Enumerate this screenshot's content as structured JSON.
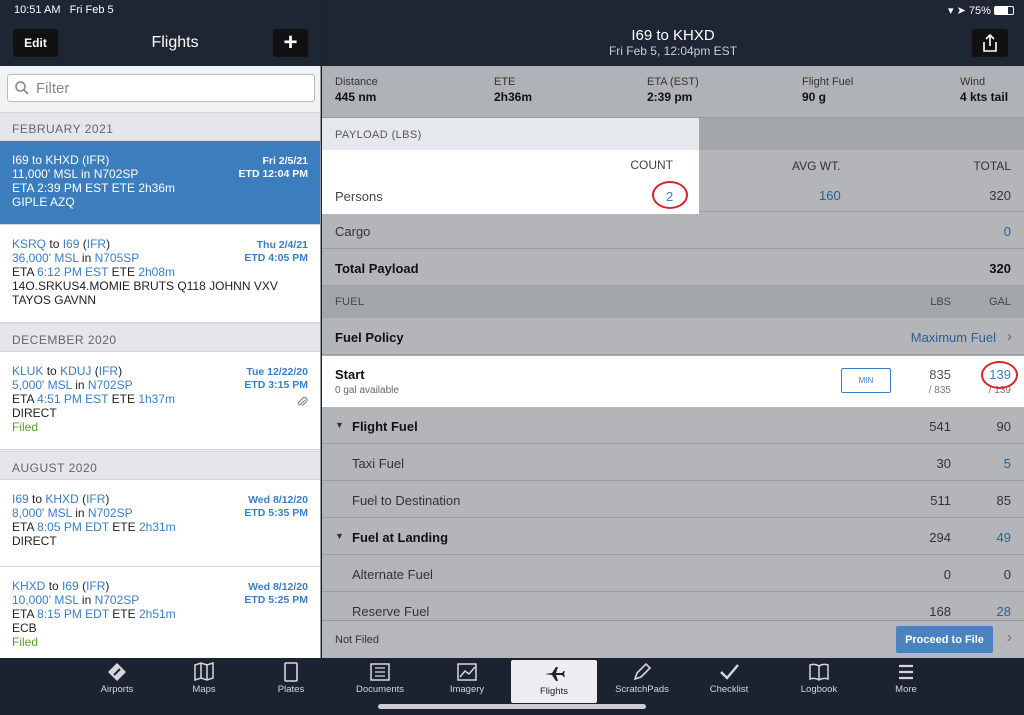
{
  "status": {
    "time": "10:51 AM",
    "date": "Fri Feb 5",
    "battery": "75%"
  },
  "left_header": {
    "edit_label": "Edit",
    "title": "Flights",
    "add_label": "+"
  },
  "filter": {
    "placeholder": "Filter"
  },
  "sections": [
    "FEBRUARY 2021",
    "DECEMBER 2020",
    "AUGUST 2020"
  ],
  "flights": [
    {
      "from": "I69",
      "to": "KHXD",
      "rules": "IFR",
      "date": "Fri 2/5/21",
      "etd": "ETD 12:04 PM",
      "alt": "11,000' MSL",
      "aircraft": "N702SP",
      "eta": "2:39 PM EST",
      "ete": "2h36m",
      "route": "GIPLE AZQ",
      "status": ""
    },
    {
      "from": "KSRQ",
      "to": "I69",
      "rules": "IFR",
      "date": "Thu 2/4/21",
      "etd": "ETD 4:05 PM",
      "alt": "36,000' MSL",
      "aircraft": "N705SP",
      "eta": "6:12 PM EST",
      "ete": "2h08m",
      "route": "14O.SRKUS4.MOMIE BRUTS Q118 JOHNN VXV TAYOS GAVNN",
      "status": ""
    },
    {
      "from": "KLUK",
      "to": "KDUJ",
      "rules": "IFR",
      "date": "Tue 12/22/20",
      "etd": "ETD 3:15 PM",
      "alt": "5,000' MSL",
      "aircraft": "N702SP",
      "eta": "4:51 PM EST",
      "ete": "1h37m",
      "route": "DIRECT",
      "status": "Filed"
    },
    {
      "from": "I69",
      "to": "KHXD",
      "rules": "IFR",
      "date": "Wed 8/12/20",
      "etd": "ETD 5:35 PM",
      "alt": "8,000' MSL",
      "aircraft": "N702SP",
      "eta": "8:05 PM EDT",
      "ete": "2h31m",
      "route": "DIRECT",
      "status": ""
    },
    {
      "from": "KHXD",
      "to": "I69",
      "rules": "IFR",
      "date": "Wed 8/12/20",
      "etd": "ETD 5:25 PM",
      "alt": "10,000' MSL",
      "aircraft": "N702SP",
      "eta": "8:15 PM EDT",
      "ete": "2h51m",
      "route": "ECB",
      "status": "Filed"
    }
  ],
  "words": {
    "to": "to",
    "in": "in",
    "eta": "ETA",
    "ete": "ETE"
  },
  "right_header": {
    "title": "I69 to KHXD",
    "subtitle": "Fri Feb 5, 12:04pm EST"
  },
  "summary": [
    {
      "label": "Distance",
      "value": "445 nm"
    },
    {
      "label": "ETE",
      "value": "2h36m"
    },
    {
      "label": "ETA (EST)",
      "value": "2:39 pm"
    },
    {
      "label": "Flight Fuel",
      "value": "90 g"
    },
    {
      "label": "Wind",
      "value": "4 kts tail"
    }
  ],
  "payload": {
    "header": "PAYLOAD (LBS)",
    "col_count": "COUNT",
    "col_avg": "AVG WT.",
    "col_total": "TOTAL",
    "persons_label": "Persons",
    "persons_count": "2",
    "persons_avg": "160",
    "persons_total": "320",
    "cargo_label": "Cargo",
    "cargo_total": "0",
    "total_label": "Total Payload",
    "total_value": "320"
  },
  "fuel": {
    "header": "FUEL",
    "col_lbs": "LBS",
    "col_gal": "GAL",
    "policy_label": "Fuel Policy",
    "policy_value": "Maximum Fuel",
    "start_label": "Start",
    "start_sub": "0 gal available",
    "min_label": "MIN",
    "start_lbs": "835",
    "start_lbs_max": "/ 835",
    "start_gal": "139",
    "start_gal_max": "/ 139",
    "rows": [
      {
        "label": "Flight Fuel",
        "lbs": "541",
        "gal": "90"
      },
      {
        "label": "Taxi Fuel",
        "lbs": "30",
        "gal": "5"
      },
      {
        "label": "Fuel to Destination",
        "lbs": "511",
        "gal": "85"
      },
      {
        "label": "Fuel at Landing",
        "lbs": "294",
        "gal": "49"
      },
      {
        "label": "Alternate Fuel",
        "lbs": "0",
        "gal": "0"
      },
      {
        "label": "Reserve Fuel",
        "lbs": "168",
        "gal": "28"
      }
    ]
  },
  "bottom": {
    "status": "Not Filed",
    "proceed_label": "Proceed to File"
  },
  "tabs": [
    "Airports",
    "Maps",
    "Plates",
    "Documents",
    "Imagery",
    "Flights",
    "ScratchPads",
    "Checklist",
    "Logbook",
    "More"
  ]
}
